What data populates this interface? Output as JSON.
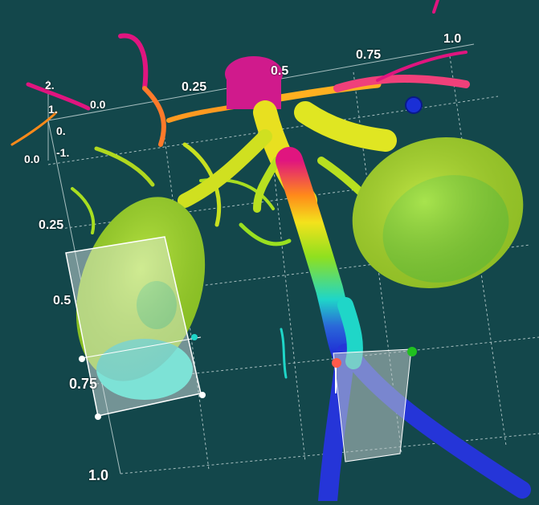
{
  "scene": {
    "background": "#13474b",
    "subject": "3D isosurface rendering of kidneys with renal vessels and ureters, colored by depth",
    "colormap": [
      "#e0157f",
      "#ff8a1a",
      "#f3e21c",
      "#8fe01f",
      "#1fd6c8",
      "#1f2fd6"
    ],
    "grid_line_color": "#d8e6e6"
  },
  "axes": {
    "top": [
      "0.0",
      "0.25",
      "0.5",
      "0.75",
      "1.0"
    ],
    "left": [
      "0.0",
      "0.25",
      "0.5",
      "0.75",
      "1.0"
    ],
    "z": [
      "2.",
      "1.",
      "0.",
      "-1."
    ]
  },
  "widgets": {
    "box_widgets": 2,
    "handle_colors": [
      "#1a2fd6",
      "#ff5a4a",
      "#20c020",
      "#ffffff"
    ]
  }
}
